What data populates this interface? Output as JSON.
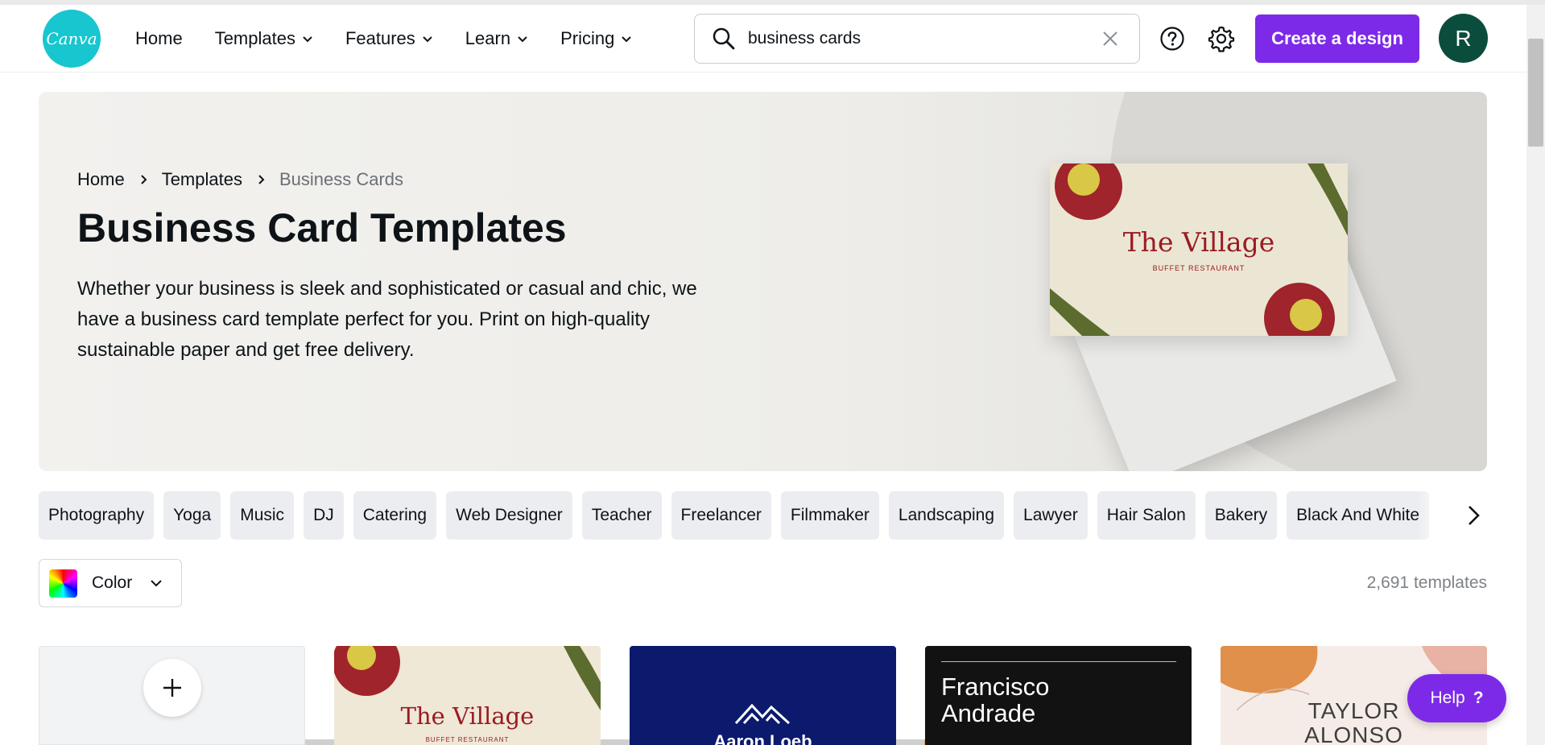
{
  "header": {
    "logo_text": "Canva",
    "nav": [
      {
        "label": "Home",
        "has_dropdown": false
      },
      {
        "label": "Templates",
        "has_dropdown": true
      },
      {
        "label": "Features",
        "has_dropdown": true
      },
      {
        "label": "Learn",
        "has_dropdown": true
      },
      {
        "label": "Pricing",
        "has_dropdown": true
      }
    ],
    "search": {
      "value": "business cards",
      "icon": "search-icon",
      "clear_icon": "close-icon"
    },
    "help_icon": "question-circle-icon",
    "settings_icon": "gear-icon",
    "create_button": "Create a design",
    "avatar_initial": "R"
  },
  "hero": {
    "breadcrumb": [
      "Home",
      "Templates",
      "Business Cards"
    ],
    "title": "Business Card Templates",
    "description": "Whether your business is sleek and sophisticated or casual and chic, we have a business card template perfect for you. Print on high-quality sustainable paper and get free delivery.",
    "card_title": "The Village",
    "card_subtitle": "BUFFET RESTAURANT"
  },
  "categories": [
    "Photography",
    "Yoga",
    "Music",
    "DJ",
    "Catering",
    "Web Designer",
    "Teacher",
    "Freelancer",
    "Filmmaker",
    "Landscaping",
    "Lawyer",
    "Hair Salon",
    "Bakery",
    "Black And White"
  ],
  "filter": {
    "color_label": "Color"
  },
  "results": {
    "count": "2,691 templates"
  },
  "templates": {
    "village_title": "The Village",
    "village_subtitle": "BUFFET RESTAURANT",
    "navy_name": "Aaron Loeb",
    "black_name_line1": "Francisco",
    "black_name_line2": "Andrade",
    "taylor_line1": "TAYLOR",
    "taylor_line2": "ALONSO"
  },
  "help_button": {
    "label": "Help",
    "icon": "question-icon"
  },
  "colors": {
    "brand_purple": "#7d2ae8",
    "logo_teal": "#17c6cf",
    "avatar_green": "#0b4d3c"
  }
}
